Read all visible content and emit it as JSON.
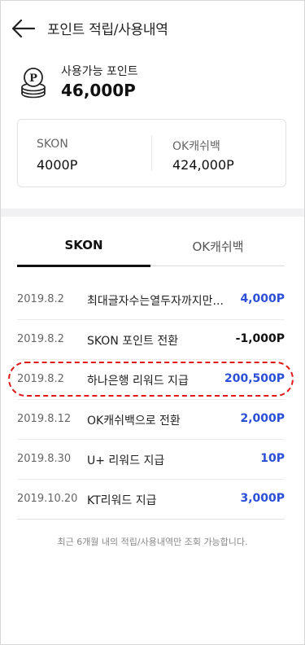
{
  "header": {
    "title": "포인트 적립/사용내역"
  },
  "points": {
    "label": "사용가능 포인트",
    "value": "46,000P"
  },
  "balances": [
    {
      "label": "SKON",
      "value": "4000P"
    },
    {
      "label": "OK캐쉬백",
      "value": "424,000P"
    }
  ],
  "tabs": [
    {
      "label": "SKON",
      "active": true
    },
    {
      "label": "OK캐쉬백",
      "active": false
    }
  ],
  "history": [
    {
      "date": "2019.8.2",
      "desc": "최대글자수는열두자까지만...",
      "amount": "4,000P",
      "type": "plus"
    },
    {
      "date": "2019.8.2",
      "desc": "SKON 포인트 전환",
      "amount": "-1,000P",
      "type": "minus"
    },
    {
      "date": "2019.8.2",
      "desc": "하나은행 리워드 지급",
      "amount": "200,500P",
      "type": "plus"
    },
    {
      "date": "2019.8.12",
      "desc": "OK캐쉬백으로 전환",
      "amount": "2,000P",
      "type": "plus"
    },
    {
      "date": "2019.8.30",
      "desc": "U+ 리워드 지급",
      "amount": "10P",
      "type": "plus"
    },
    {
      "date": "2019.10.20",
      "desc": "KT리워드 지급",
      "amount": "3,000P",
      "type": "plus"
    }
  ],
  "footer_note": "최근 6개월 내의 적립/사용내역만 조회 가능합니다.",
  "colors": {
    "accent_blue": "#2a4fd6",
    "highlight_red": "#e01818"
  }
}
